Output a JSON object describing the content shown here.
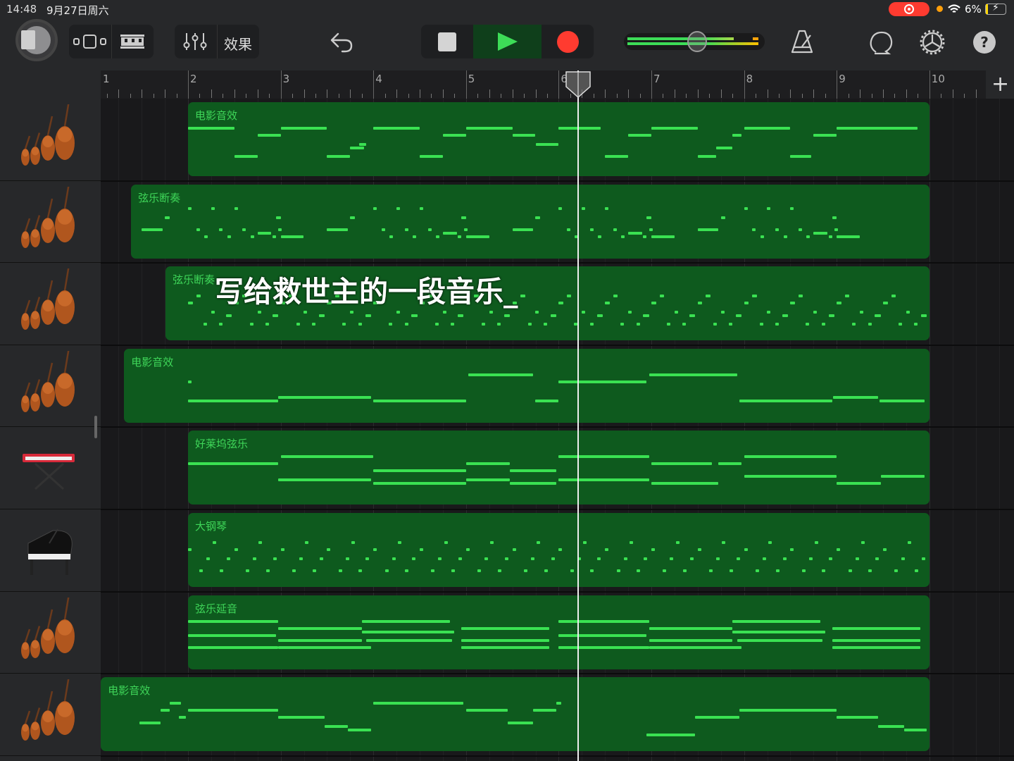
{
  "status_bar": {
    "time": "14:48",
    "date": "9月27日周六",
    "battery": "6%"
  },
  "toolbar": {
    "effects_label": "效果",
    "add_track": "+"
  },
  "colors": {
    "region": "#0e5a1e",
    "note": "#3ae152",
    "record": "#ff3b30",
    "play": "#3ddc57"
  },
  "volume": 0.52,
  "ruler": {
    "bars": [
      "1",
      "2",
      "3",
      "4",
      "5",
      "6",
      "7",
      "8",
      "9",
      "10"
    ]
  },
  "playhead_beat": 20.85,
  "caption": "写给救世主的一段音乐_",
  "tracks": [
    {
      "icon": "strings",
      "region": {
        "name": "电影音效",
        "start": 4,
        "end": 36,
        "notes": [
          [
            4,
            2,
            22
          ],
          [
            6,
            1,
            6
          ],
          [
            7,
            1,
            18
          ],
          [
            8,
            2,
            22
          ],
          [
            10,
            1,
            6
          ],
          [
            11,
            0.6,
            11
          ],
          [
            11.4,
            0.3,
            13
          ],
          [
            12,
            2,
            22
          ],
          [
            14,
            1,
            6
          ],
          [
            15,
            1,
            18
          ],
          [
            16,
            2,
            22
          ],
          [
            18,
            1,
            18
          ],
          [
            19,
            1,
            13
          ],
          [
            20,
            1.8,
            22
          ],
          [
            22,
            1,
            6
          ],
          [
            23,
            1,
            18
          ],
          [
            24,
            2,
            22
          ],
          [
            26,
            0.8,
            6
          ],
          [
            26.8,
            0.7,
            11
          ],
          [
            27.5,
            0.4,
            18
          ],
          [
            28,
            2,
            22
          ],
          [
            30,
            0.9,
            6
          ],
          [
            31,
            1,
            18
          ],
          [
            32,
            3.5,
            22
          ]
        ]
      }
    },
    {
      "icon": "strings",
      "region": {
        "name": "弦乐断奏",
        "start": 1.54,
        "end": 36,
        "pattern": {
          "origin": 2,
          "every": 8,
          "count": 4,
          "notes": [
            [
              0,
              0.9,
              11
            ],
            [
              1,
              0.2,
              18
            ],
            [
              2,
              0.15,
              23
            ],
            [
              2.35,
              0.15,
              11
            ],
            [
              2.7,
              0.1,
              7
            ],
            [
              3,
              0.15,
              23
            ],
            [
              3.35,
              0.15,
              11
            ],
            [
              3.7,
              0.1,
              7
            ],
            [
              4,
              0.15,
              23
            ],
            [
              4.35,
              0.15,
              11
            ],
            [
              4.7,
              0.1,
              7
            ],
            [
              5,
              0.6,
              9
            ],
            [
              5.65,
              0.1,
              7
            ],
            [
              5.8,
              0.2,
              18
            ],
            [
              5.9,
              0.15,
              11
            ],
            [
              6,
              1,
              7
            ]
          ]
        }
      }
    },
    {
      "icon": "strings",
      "region": {
        "name": "弦乐断奏",
        "start": 3.03,
        "end": 36,
        "pattern": {
          "origin": 4,
          "every": 2,
          "count": 16,
          "notes": [
            [
              0,
              0.2,
              16
            ],
            [
              0.35,
              0.2,
              20
            ],
            [
              0.67,
              0.1,
              4
            ],
            [
              1,
              0.1,
              11
            ],
            [
              1.35,
              0.15,
              4
            ],
            [
              1.65,
              0.25,
              9
            ]
          ]
        }
      }
    },
    {
      "icon": "strings",
      "region": {
        "name": "电影音效",
        "start": 1.24,
        "end": 36,
        "notes": [
          [
            4,
            0.1,
            18
          ],
          [
            4,
            3.9,
            7
          ],
          [
            7.9,
            4,
            9
          ],
          [
            12,
            4,
            7
          ],
          [
            16.1,
            2.8,
            22
          ],
          [
            19,
            1,
            7
          ],
          [
            20,
            3.8,
            18
          ],
          [
            23.9,
            3.8,
            22
          ],
          [
            27.8,
            4,
            7
          ],
          [
            31.85,
            1.95,
            9
          ],
          [
            33.85,
            1.95,
            7
          ]
        ]
      }
    },
    {
      "icon": "keyboard",
      "region": {
        "name": "好莱坞弦乐",
        "start": 4,
        "end": 36,
        "notes": [
          [
            4,
            3.9,
            18
          ],
          [
            8,
            4,
            22
          ],
          [
            7.9,
            4,
            9
          ],
          [
            12,
            4,
            14
          ],
          [
            12,
            4,
            7
          ],
          [
            16,
            1.9,
            18
          ],
          [
            16,
            1.9,
            9
          ],
          [
            17.9,
            2,
            14
          ],
          [
            17.9,
            2,
            7
          ],
          [
            20,
            3.9,
            22
          ],
          [
            20,
            3.9,
            9
          ],
          [
            24,
            2.6,
            18
          ],
          [
            26.9,
            1,
            18
          ],
          [
            24,
            2.9,
            7
          ],
          [
            28,
            4,
            22
          ],
          [
            28,
            4,
            11
          ],
          [
            32,
            1.9,
            7
          ],
          [
            33.9,
            1.9,
            11
          ]
        ]
      }
    },
    {
      "icon": "piano",
      "region": {
        "name": "大钢琴",
        "start": 4,
        "end": 36,
        "pattern": {
          "origin": 4,
          "every": 2,
          "count": 16,
          "notes": [
            [
              0,
              0.15,
              16
            ],
            [
              0.5,
              0.1,
              4
            ],
            [
              0.8,
              0.15,
              11
            ],
            [
              1.05,
              0.15,
              20
            ],
            [
              1.37,
              0.1,
              4
            ],
            [
              1.67,
              0.15,
              11
            ]
          ]
        }
      }
    },
    {
      "icon": "strings",
      "region": {
        "name": "弦乐延音",
        "start": 4,
        "end": 36,
        "pattern": {
          "origin": 4,
          "every": 16,
          "count": 2,
          "notes": [
            [
              0,
              3.9,
              22
            ],
            [
              0,
              3.8,
              14
            ],
            [
              0,
              3.9,
              7
            ],
            [
              3.9,
              3.6,
              18
            ],
            [
              3.9,
              3.6,
              11
            ],
            [
              3.9,
              4,
              7
            ],
            [
              7.5,
              3.8,
              22
            ],
            [
              7.5,
              4,
              16
            ],
            [
              7.7,
              3.7,
              11
            ],
            [
              11.8,
              3.8,
              18
            ],
            [
              11.8,
              3.8,
              11
            ],
            [
              11.8,
              3.8,
              7
            ]
          ]
        }
      }
    },
    {
      "icon": "strings",
      "region": {
        "name": "电影音效",
        "start": 0.24,
        "end": 36,
        "notes": [
          [
            1.9,
            0.9,
            11
          ],
          [
            2.8,
            0.4,
            18
          ],
          [
            3.2,
            0.5,
            22
          ],
          [
            3.6,
            0.3,
            14
          ],
          [
            4,
            3.9,
            18
          ],
          [
            7.9,
            2,
            14
          ],
          [
            9.9,
            1,
            9
          ],
          [
            10.9,
            1,
            7
          ],
          [
            12,
            3.9,
            22
          ],
          [
            16,
            1.8,
            18
          ],
          [
            17.8,
            1.1,
            11
          ],
          [
            18.9,
            1,
            18
          ],
          [
            19.9,
            0.2,
            22
          ],
          [
            23.8,
            2.1,
            4
          ],
          [
            25.9,
            1.9,
            14
          ],
          [
            27.8,
            4.2,
            18
          ],
          [
            32,
            1.8,
            14
          ],
          [
            33.8,
            1.1,
            9
          ],
          [
            34.9,
            1,
            7
          ]
        ]
      }
    }
  ]
}
